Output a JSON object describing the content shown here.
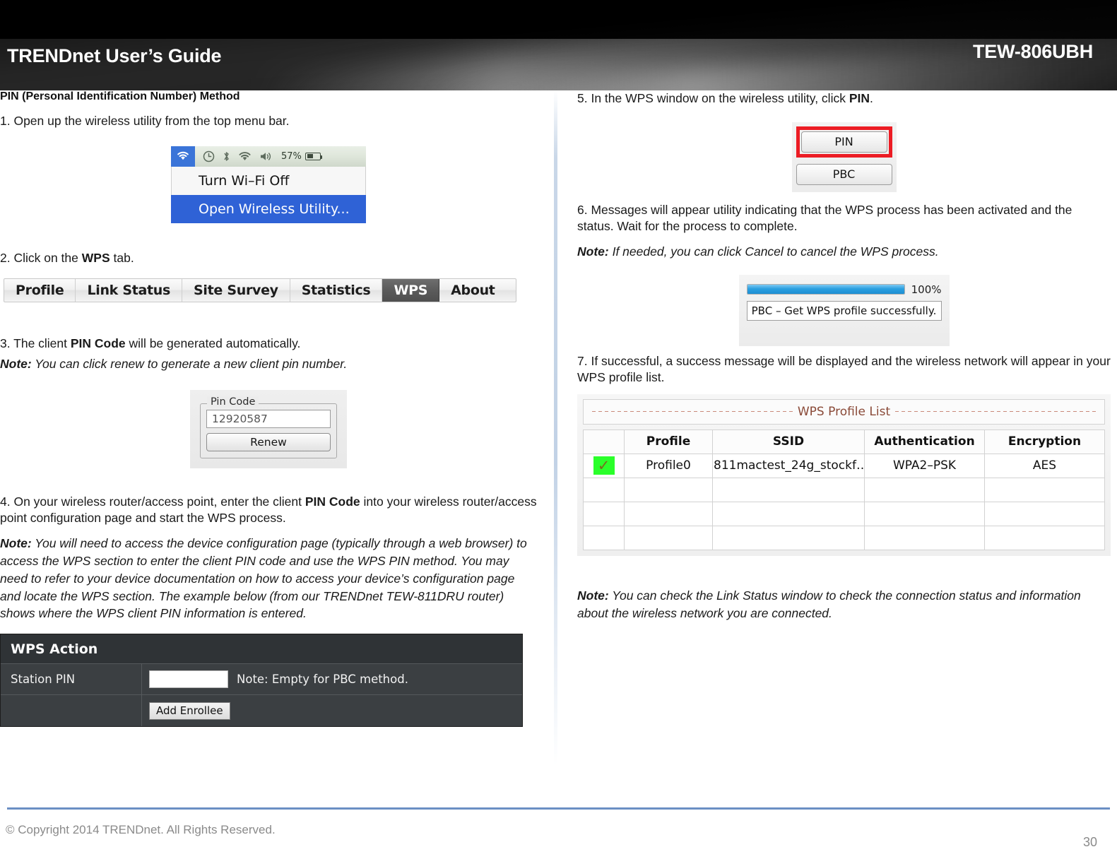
{
  "header": {
    "title": "TRENDnet User’s Guide",
    "model": "TEW-806UBH"
  },
  "left_column": {
    "section_heading": "PIN (Personal Identification Number) Method",
    "step1": "1. Open up the wireless utility from the top menu bar.",
    "menu_bar_figure": {
      "battery_percent": "57%",
      "items": [
        {
          "label": "Turn Wi–Fi Off",
          "selected": false
        },
        {
          "label": "Open Wireless Utility...",
          "selected": true
        }
      ]
    },
    "step2_prefix": "2. Click on the ",
    "step2_bold": "WPS",
    "step2_suffix": " tab.",
    "tabs_figure": {
      "tabs": [
        {
          "label": "Profile",
          "selected": false
        },
        {
          "label": "Link Status",
          "selected": false
        },
        {
          "label": "Site Survey",
          "selected": false
        },
        {
          "label": "Statistics",
          "selected": false
        },
        {
          "label": "WPS",
          "selected": true
        },
        {
          "label": "About",
          "selected": false
        }
      ]
    },
    "step3_prefix": "3.  The client ",
    "step3_bold": "PIN Code",
    "step3_suffix": " will be generated automatically.",
    "note3_label": "Note:",
    "note3_text": " You can click renew to generate a new client pin number.",
    "pin_code_figure": {
      "legend": "Pin Code",
      "value": "12920587",
      "button": "Renew"
    },
    "step4_prefix": "4. On your wireless router/access point, enter the client ",
    "step4_bold": "PIN Code",
    "step4_suffix": " into your wireless router/access point configuration page and start the WPS process.",
    "note4_label": "Note:",
    "note4_text": " You will need to access the device configuration page (typically through a web browser) to access the WPS section to enter the client PIN code and use the WPS PIN method. You may need to refer to your device documentation on how to access your device’s configuration page and locate the WPS section. The example below (from our TRENDnet TEW-811DRU router) shows where the WPS client PIN information is entered.",
    "wps_action_figure": {
      "title": "WPS Action",
      "row1_label": "Station PIN",
      "row1_input_value": "",
      "row1_note": "Note: Empty for PBC method.",
      "row2_label": "",
      "row2_button": "Add Enrollee"
    }
  },
  "right_column": {
    "step5_prefix": "5. In the WPS window on the wireless utility, click ",
    "step5_bold": "PIN",
    "step5_suffix": ".",
    "pin_pbc_figure": {
      "pin_button": "PIN",
      "pbc_button": "PBC",
      "highlight_color": "#ec1c24"
    },
    "step6": "6. Messages will appear utility indicating that the WPS process has been activated and the status. Wait for the process to complete.",
    "note6_label": "Note:",
    "note6_text": " If needed, you can click Cancel to cancel the WPS process.",
    "progress_figure": {
      "percent_label": "100%",
      "percent_value": 100,
      "message": "PBC – Get WPS profile successfully.",
      "bar_color": "#2a9fe0"
    },
    "step7": "7. If successful, a success message will be displayed and the wireless network will appear in your WPS profile list.",
    "profile_list_figure": {
      "caption": "WPS Profile List",
      "columns": [
        "",
        "Profile",
        "SSID",
        "Authentication",
        "Encryption"
      ],
      "rows": [
        {
          "checked": true,
          "check_glyph": "✓",
          "profile": "Profile0",
          "ssid": "811mactest_24g_stockf…",
          "authentication": "WPA2–PSK",
          "encryption": "AES"
        }
      ],
      "empty_row_count": 3
    },
    "note7_label": "Note:",
    "note7_text": " You can check the Link Status window to check the connection status and information about the wireless network you are connected."
  },
  "footer": {
    "copyright": "© Copyright 2014 TRENDnet. All Rights Reserved.",
    "page_number": "30",
    "rule_color": "#6b8fc4"
  }
}
